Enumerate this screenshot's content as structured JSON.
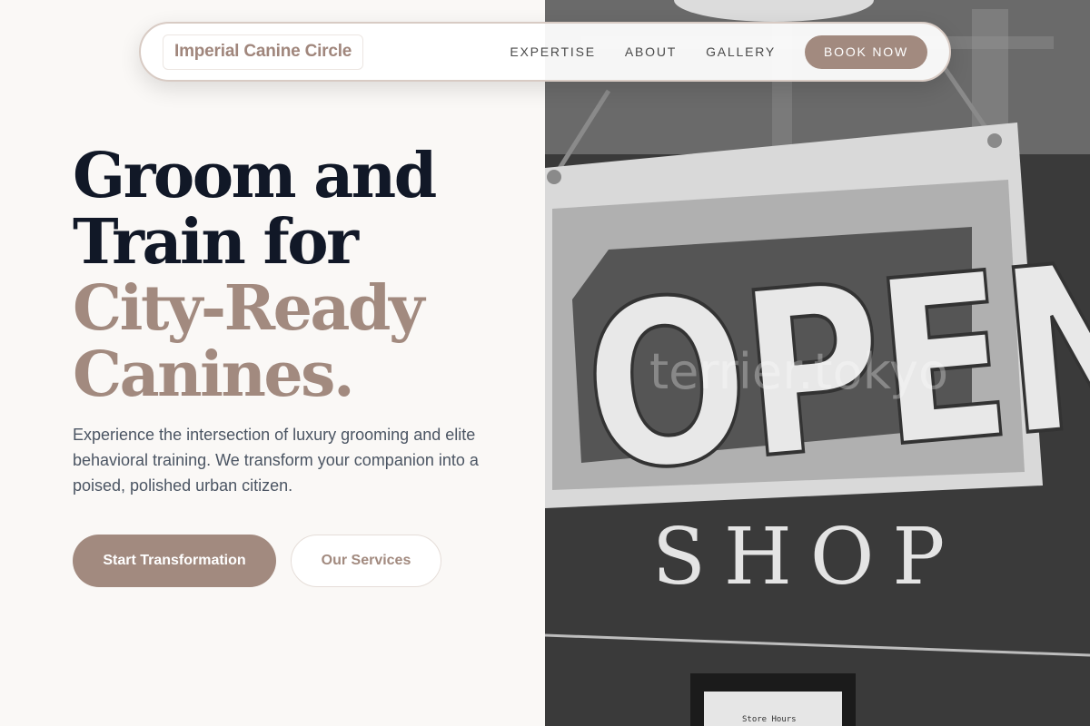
{
  "nav": {
    "brand": "Imperial Canine Circle",
    "links": [
      "EXPERTISE",
      "ABOUT",
      "GALLERY"
    ],
    "book_label": "BOOK NOW"
  },
  "hero": {
    "line1": "Groom and",
    "line2": "Train for",
    "line3": "City-Ready",
    "line4": "Canines.",
    "description": "Experience the intersection of luxury grooming and elite behavioral training. We transform your companion into a poised, polished urban citizen.",
    "primary_cta": "Start Transformation",
    "secondary_cta": "Our Services"
  },
  "photo": {
    "sign_text": "OPEN",
    "shop_text": "SHOP",
    "watermark": "terrier.tokyo",
    "hours_card": "Store Hours"
  },
  "colors": {
    "accent": "#a28a7f",
    "heading": "#111827",
    "body": "#4b5563",
    "background": "#faf8f6"
  }
}
